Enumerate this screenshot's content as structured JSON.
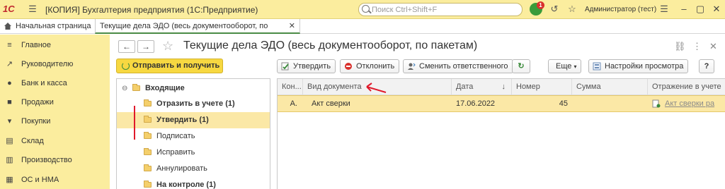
{
  "titlebar": {
    "logo": "1С",
    "title": "[КОПИЯ] Бухгалтерия предприятия  (1С:Предприятие)",
    "search_placeholder": "Поиск Ctrl+Shift+F",
    "notifications_count": "1",
    "user": "Администратор (тест)"
  },
  "tabs": {
    "home": "Начальная страница",
    "active": "Текущие дела ЭДО (весь документооборот, по пакетам)"
  },
  "sidebar": {
    "items": [
      {
        "label": "Главное",
        "icon": "menu-icon"
      },
      {
        "label": "Руководителю",
        "icon": "trend-icon"
      },
      {
        "label": "Банк и касса",
        "icon": "coins-icon"
      },
      {
        "label": "Продажи",
        "icon": "cart-icon"
      },
      {
        "label": "Покупки",
        "icon": "basket-icon"
      },
      {
        "label": "Склад",
        "icon": "warehouse-icon"
      },
      {
        "label": "Производство",
        "icon": "factory-icon"
      },
      {
        "label": "ОС и НМА",
        "icon": "building-icon"
      }
    ]
  },
  "main": {
    "title": "Текущие дела ЭДО (весь документооборот, по пакетам)",
    "send_receive": "Отправить и получить",
    "toolbar": {
      "approve": "Утвердить",
      "reject": "Отклонить",
      "change_responsible": "Сменить ответственного",
      "more": "Еще",
      "view_settings": "Настройки просмотра",
      "help": "?"
    }
  },
  "tree": {
    "root": "Входящие",
    "items": [
      {
        "label": "Отразить в учете (1)",
        "bold": true
      },
      {
        "label": "Утвердить (1)",
        "bold": true,
        "selected": true
      },
      {
        "label": "Подписать",
        "bold": false
      },
      {
        "label": "Исправить",
        "bold": false
      },
      {
        "label": "Аннулировать",
        "bold": false
      },
      {
        "label": "На контроле (1)",
        "bold": true
      }
    ]
  },
  "grid": {
    "columns": [
      "Кон...",
      "Вид документа",
      "Дата",
      "Номер",
      "Сумма",
      "Отражение в учете"
    ],
    "sort_indicator": "↓",
    "rows": [
      {
        "kon": "А.",
        "doc_type": "Акт сверки",
        "date": "17.06.2022",
        "number": "45",
        "sum": "",
        "reflection": "Акт сверки ра"
      }
    ]
  },
  "colors": {
    "accent_yellow": "#fbed9e",
    "primary_button": "#f7d841",
    "selection": "#fbe8a6",
    "annotation_red": "#e0192b"
  }
}
